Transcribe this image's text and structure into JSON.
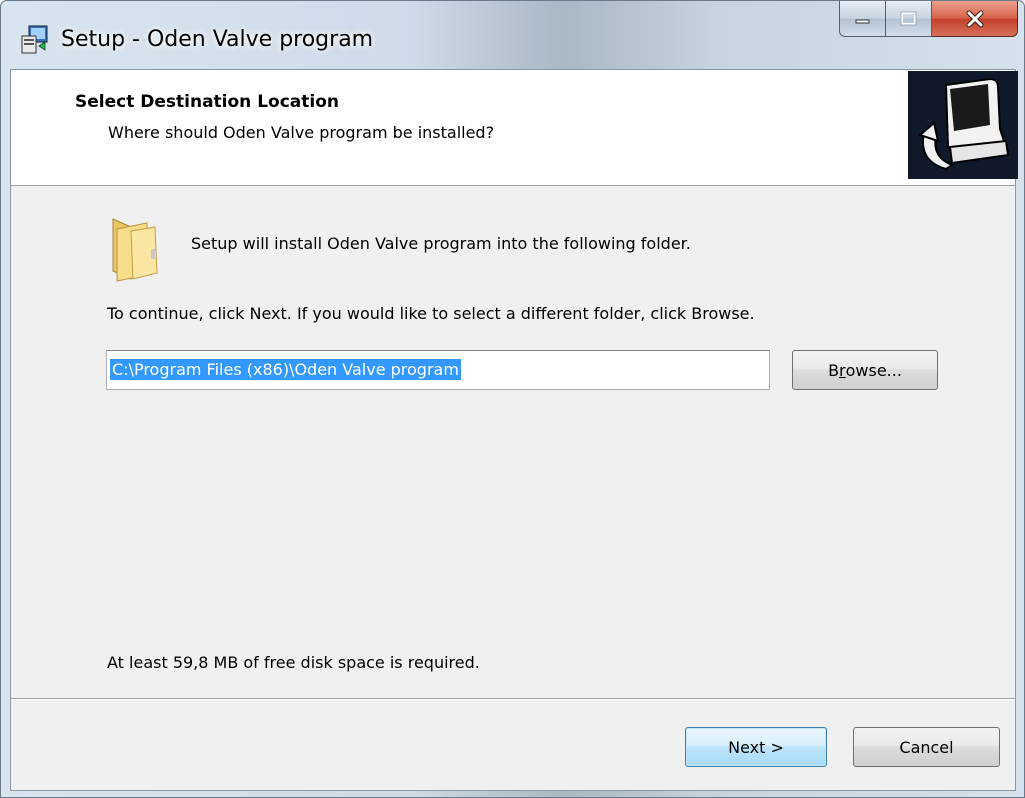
{
  "window": {
    "title": "Setup - Oden Valve program"
  },
  "header": {
    "title": "Select Destination Location",
    "subtitle": "Where should Oden Valve program be installed?"
  },
  "body": {
    "intro": "Setup will install Oden Valve program into the following folder.",
    "instruction": "To continue, click Next. If you would like to select a different folder, click Browse.",
    "path_value": "C:\\Program Files (x86)\\Oden Valve program",
    "browse_pre": "B",
    "browse_u": "r",
    "browse_post": "owse...",
    "disk_space": "At least 59,8 MB of free disk space is required."
  },
  "footer": {
    "next_label": "Next >",
    "cancel_label": "Cancel"
  },
  "icons": {
    "app": "setup-app-icon",
    "folder": "folder-icon",
    "wizard": "computer-install-icon",
    "minimize": "minimize-icon",
    "maximize": "maximize-icon",
    "close": "close-icon"
  },
  "colors": {
    "selection": "#3399ff",
    "close_button": "#c94a34",
    "wizard_bg": "#10192a"
  }
}
